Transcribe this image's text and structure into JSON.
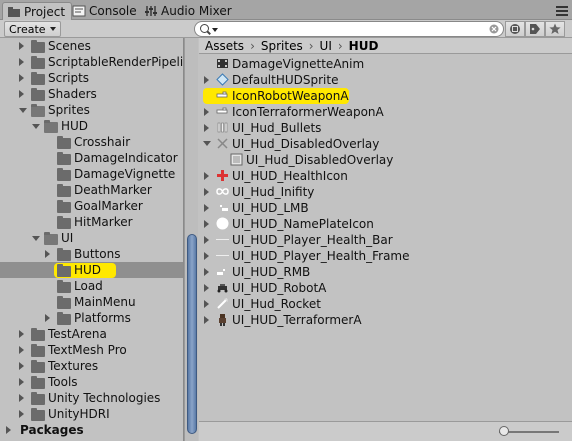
{
  "tabs": [
    {
      "label": "Project",
      "icon": "folder-icon",
      "active": true
    },
    {
      "label": "Console",
      "icon": "console-icon",
      "active": false
    },
    {
      "label": "Audio Mixer",
      "icon": "audio-mixer-icon",
      "active": false
    }
  ],
  "toolbar": {
    "create_label": "Create",
    "search_placeholder": ""
  },
  "tree": [
    {
      "label": "Scenes",
      "depth": 1,
      "arrow": "right"
    },
    {
      "label": "ScriptableRenderPipelin",
      "depth": 1,
      "arrow": "right"
    },
    {
      "label": "Scripts",
      "depth": 1,
      "arrow": "right"
    },
    {
      "label": "Shaders",
      "depth": 1,
      "arrow": "right"
    },
    {
      "label": "Sprites",
      "depth": 1,
      "arrow": "down"
    },
    {
      "label": "HUD",
      "depth": 2,
      "arrow": "down"
    },
    {
      "label": "Crosshair",
      "depth": 3,
      "arrow": "none"
    },
    {
      "label": "DamageIndicator",
      "depth": 3,
      "arrow": "none"
    },
    {
      "label": "DamageVignette",
      "depth": 3,
      "arrow": "none"
    },
    {
      "label": "DeathMarker",
      "depth": 3,
      "arrow": "none"
    },
    {
      "label": "GoalMarker",
      "depth": 3,
      "arrow": "none"
    },
    {
      "label": "HitMarker",
      "depth": 3,
      "arrow": "none"
    },
    {
      "label": "UI",
      "depth": 2,
      "arrow": "down"
    },
    {
      "label": "Buttons",
      "depth": 3,
      "arrow": "right"
    },
    {
      "label": "HUD",
      "depth": 3,
      "arrow": "none",
      "selected": true
    },
    {
      "label": "Load",
      "depth": 3,
      "arrow": "none"
    },
    {
      "label": "MainMenu",
      "depth": 3,
      "arrow": "none"
    },
    {
      "label": "Platforms",
      "depth": 3,
      "arrow": "right"
    },
    {
      "label": "TestArena",
      "depth": 1,
      "arrow": "right"
    },
    {
      "label": "TextMesh Pro",
      "depth": 1,
      "arrow": "right"
    },
    {
      "label": "Textures",
      "depth": 1,
      "arrow": "right"
    },
    {
      "label": "Tools",
      "depth": 1,
      "arrow": "right"
    },
    {
      "label": "Unity Technologies",
      "depth": 1,
      "arrow": "right"
    },
    {
      "label": "UnityHDRI",
      "depth": 1,
      "arrow": "right"
    },
    {
      "label": "Packages",
      "depth": 0,
      "arrow": "right",
      "bold": true
    }
  ],
  "breadcrumb": [
    "Assets",
    "Sprites",
    "UI",
    "HUD"
  ],
  "assets": [
    {
      "label": "DamageVignetteAnim",
      "icon": "animation-icon",
      "arrow": "none",
      "indent": 0
    },
    {
      "label": "DefaultHUDSprite",
      "icon": "diamond-icon",
      "arrow": "right",
      "indent": 0
    },
    {
      "label": "IconRobotWeaponA",
      "icon": "weapon-sprite-icon",
      "arrow": "right",
      "indent": 0,
      "highlighted": true
    },
    {
      "label": "IconTerraformerWeaponA",
      "icon": "weapon-sprite-icon",
      "arrow": "right",
      "indent": 0
    },
    {
      "label": "UI_Hud_Bullets",
      "icon": "bullets-icon",
      "arrow": "right",
      "indent": 0
    },
    {
      "label": "UI_Hud_DisabledOverlay",
      "icon": "overlay-icon",
      "arrow": "down",
      "indent": 0
    },
    {
      "label": "UI_Hud_DisabledOverlay",
      "icon": "sprite-icon",
      "arrow": "none",
      "indent": 1
    },
    {
      "label": "UI_HUD_HealthIcon",
      "icon": "health-cross-icon",
      "arrow": "right",
      "indent": 0
    },
    {
      "label": "UI_Hud_Inifity",
      "icon": "infinity-icon",
      "arrow": "right",
      "indent": 0
    },
    {
      "label": "UI_HUD_LMB",
      "icon": "lmb-icon",
      "arrow": "right",
      "indent": 0
    },
    {
      "label": "UI_HUD_NamePlateIcon",
      "icon": "circle-icon",
      "arrow": "right",
      "indent": 0
    },
    {
      "label": "UI_HUD_Player_Health_Bar",
      "icon": "bar-icon",
      "arrow": "right",
      "indent": 0
    },
    {
      "label": "UI_HUD_Player_Health_Frame",
      "icon": "frame-icon",
      "arrow": "right",
      "indent": 0
    },
    {
      "label": "UI_HUD_RMB",
      "icon": "rmb-icon",
      "arrow": "right",
      "indent": 0
    },
    {
      "label": "UI_HUD_RobotA",
      "icon": "robot-icon",
      "arrow": "right",
      "indent": 0
    },
    {
      "label": "UI_Hud_Rocket",
      "icon": "rocket-icon",
      "arrow": "right",
      "indent": 0
    },
    {
      "label": "UI_HUD_TerraformerA",
      "icon": "terraformer-icon",
      "arrow": "right",
      "indent": 0
    }
  ],
  "colors": {
    "highlight": "#ffe800",
    "selection": "#8f8f8f",
    "scroll_thumb": "#6f8fbf"
  },
  "zoom_slider": {
    "level": 0
  }
}
